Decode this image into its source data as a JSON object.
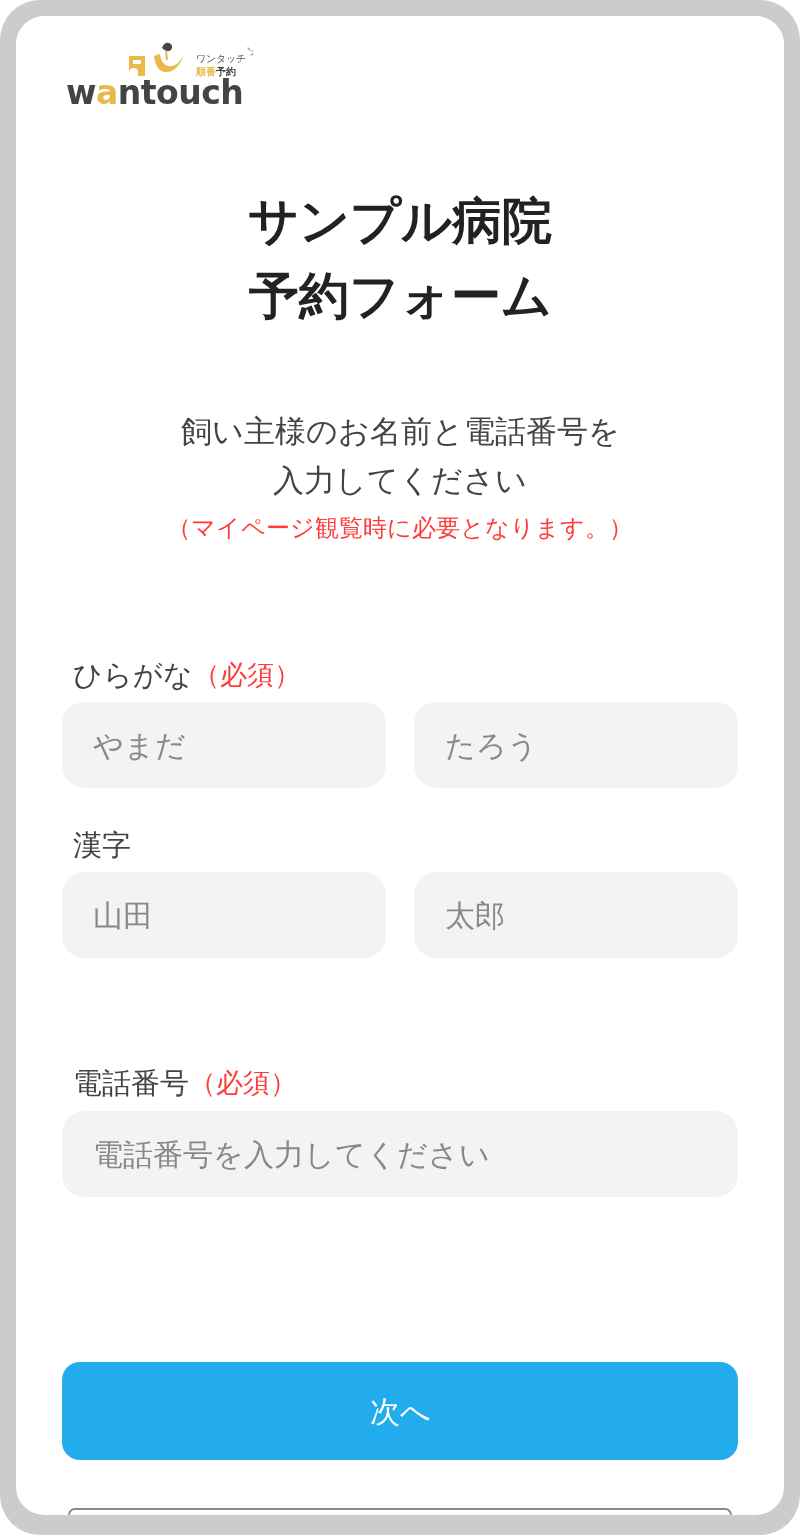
{
  "logo": {
    "tagline": "ワンタッチ",
    "subtitle": [
      {
        "text": "順番",
        "accent": true
      },
      {
        "text": "予約",
        "accent": false
      }
    ],
    "wordmark": [
      {
        "text": "w",
        "accent": false
      },
      {
        "text": "a",
        "accent": true
      },
      {
        "text": "ntouch",
        "accent": false
      }
    ]
  },
  "title_lines": [
    "サンプル病院",
    "予約フォーム"
  ],
  "instruction_lines": [
    "飼い主様のお名前と電話番号を",
    "入力してください"
  ],
  "notice": "（マイページ観覧時に必要となります。）",
  "sections": [
    {
      "fields": [
        {
          "label": "ひらがな",
          "required_mark": "（必須）",
          "inputs": [
            {
              "placeholder": "やまだ"
            },
            {
              "placeholder": "たろう"
            }
          ]
        },
        {
          "label": "漢字",
          "inputs": [
            {
              "placeholder": "山田"
            },
            {
              "placeholder": "太郎"
            }
          ]
        }
      ]
    },
    {
      "fields": [
        {
          "label": "電話番号",
          "required_mark": "（必須）",
          "inputs": [
            {
              "placeholder": "電話番号を入力してください"
            }
          ]
        }
      ]
    }
  ],
  "buttons": [
    {
      "kind": "primary",
      "label": "次へ"
    },
    {
      "kind": "outline"
    }
  ]
}
